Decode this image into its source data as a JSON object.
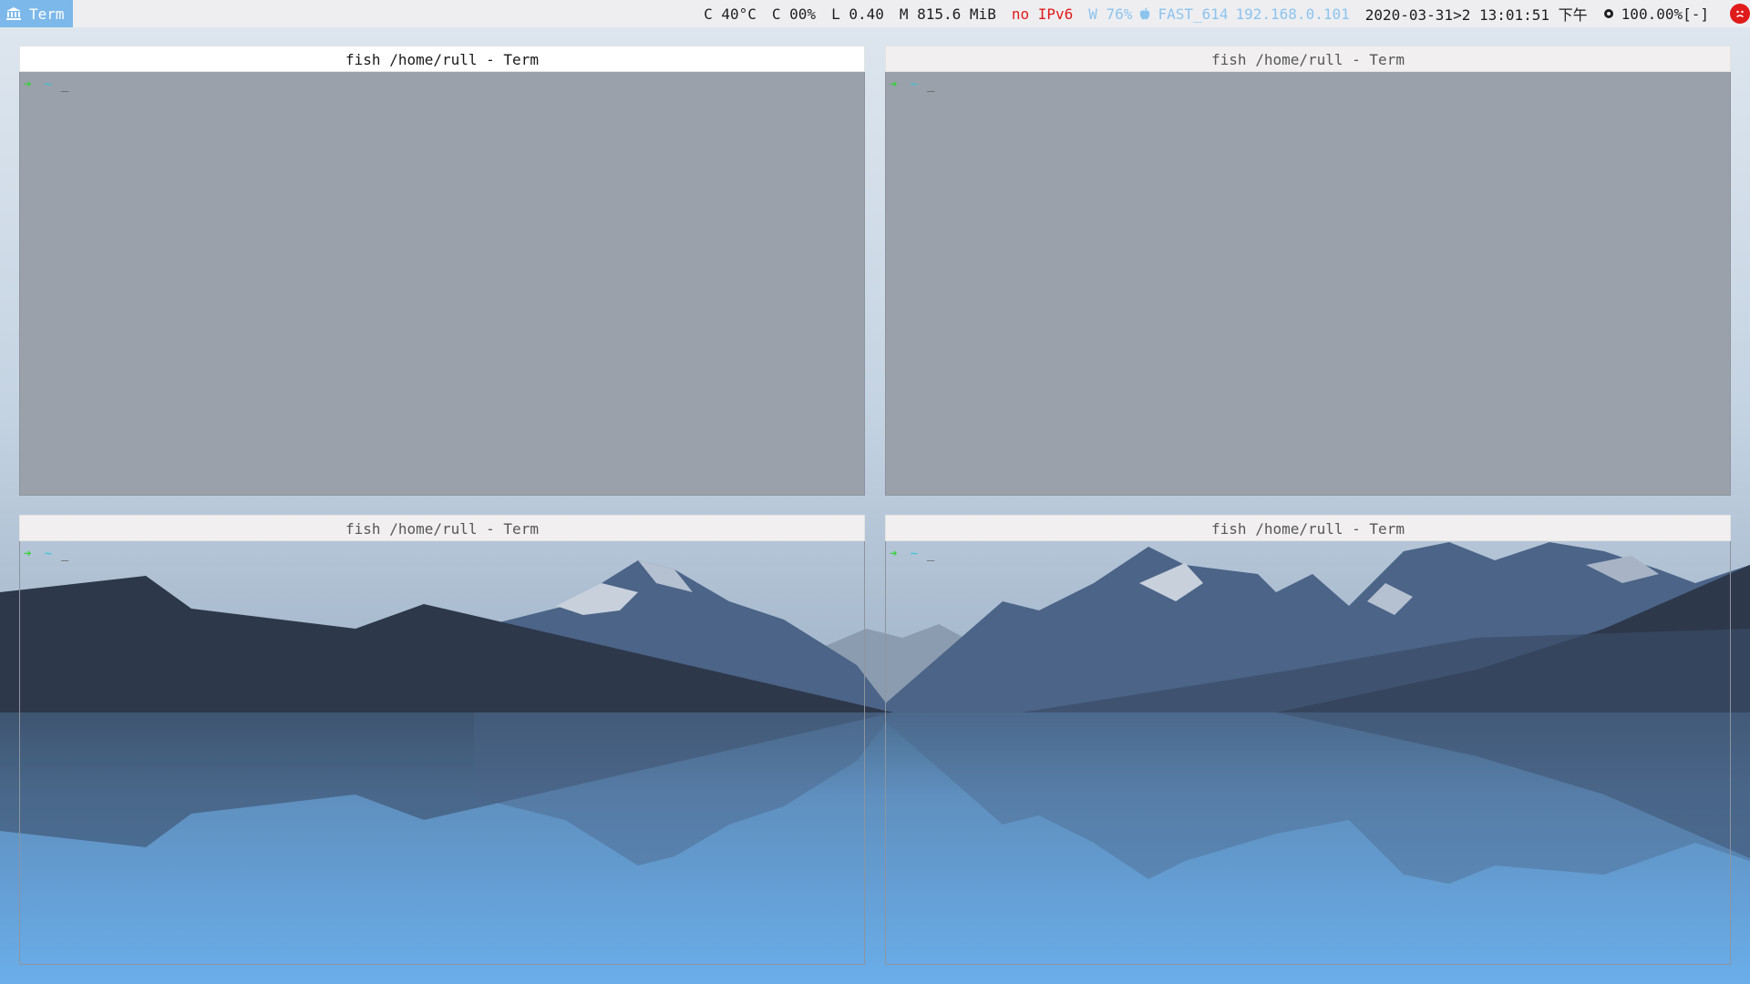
{
  "workspace": {
    "icon": "bank-icon",
    "label": "Term"
  },
  "status_bar": {
    "cpu_temp": "C 40°C",
    "cpu_usage": "C 00%",
    "load": "L 0.40",
    "memory": "M 815.6 MiB",
    "ipv6": "no IPv6",
    "wifi_strength": "W 76%",
    "wifi_icon": "apple-icon",
    "wifi_ssid": "FAST_614",
    "ip_address": "192.168.0.101",
    "datetime": "2020-03-31>2 13:01:51 下午",
    "battery_icon": "battery-icon",
    "battery": "100.00%[-]",
    "status_icon": "sad-face-icon"
  },
  "terminals": [
    {
      "title": "fish /home/rull - Term",
      "prompt_arrow": "➜",
      "prompt_dir": "~",
      "cursor": "_",
      "focused": true
    },
    {
      "title": "fish /home/rull - Term",
      "prompt_arrow": "➜",
      "prompt_dir": "~",
      "cursor": "_",
      "focused": false
    },
    {
      "title": "fish /home/rull - Term",
      "prompt_arrow": "➜",
      "prompt_dir": "~",
      "cursor": "_",
      "focused": false
    },
    {
      "title": "fish /home/rull - Term",
      "prompt_arrow": "➜",
      "prompt_dir": "~",
      "cursor": "_",
      "focused": false
    }
  ],
  "colors": {
    "workspace_bg": "#7cb8ea",
    "alert_red": "#e01b1b",
    "wifi_blue": "#8cc4ee",
    "prompt_green": "#3ccf3c",
    "prompt_cyan": "#36c6d8"
  }
}
